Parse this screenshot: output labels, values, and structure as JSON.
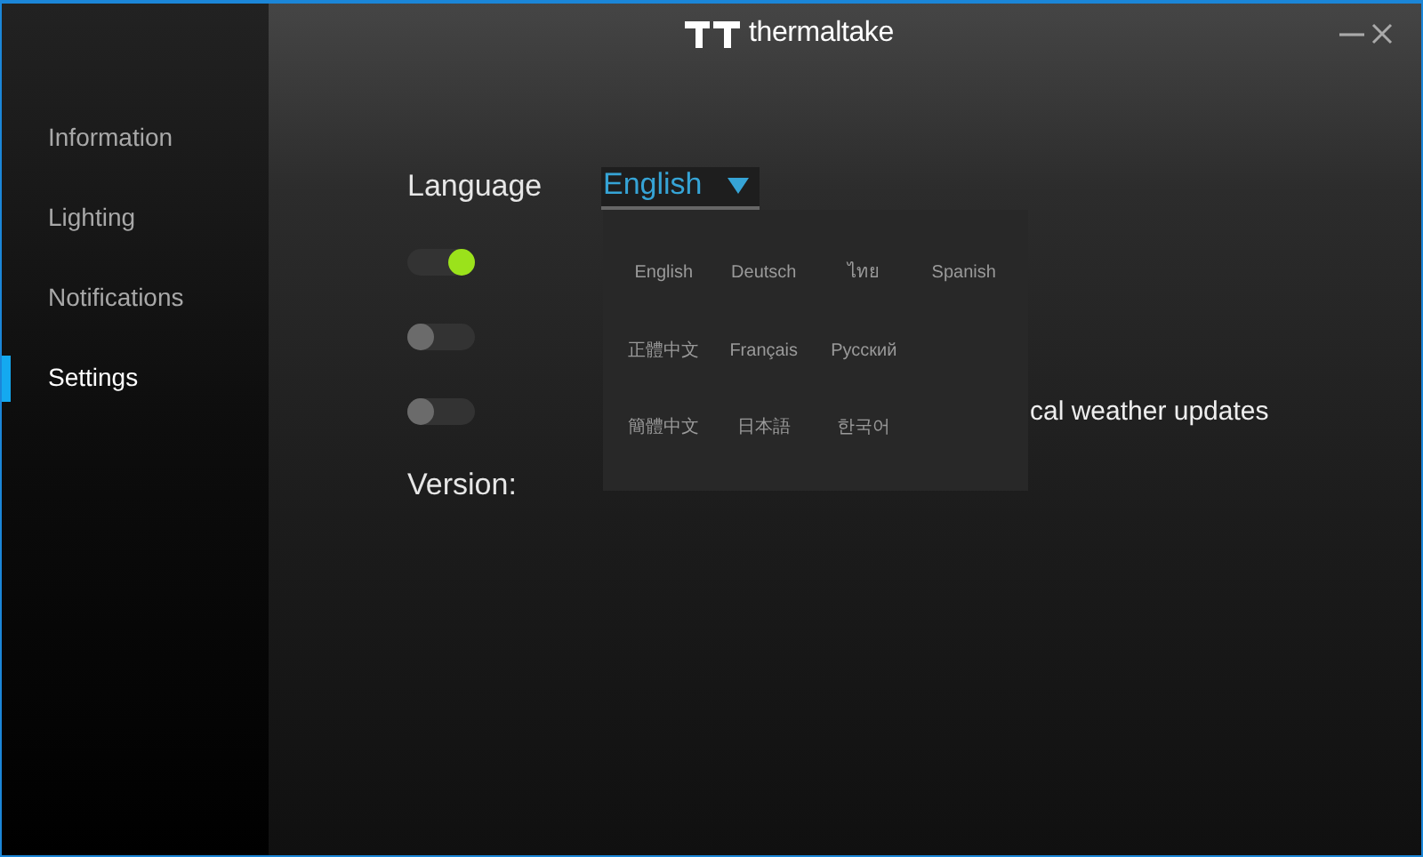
{
  "window": {
    "brand": "thermaltake"
  },
  "sidebar": {
    "items": [
      {
        "label": "Information",
        "selected": false
      },
      {
        "label": "Lighting",
        "selected": false
      },
      {
        "label": "Notifications",
        "selected": false
      },
      {
        "label": "Settings",
        "selected": true
      }
    ]
  },
  "settings": {
    "language": {
      "label": "Language",
      "value": "English",
      "expanded": true,
      "options": [
        {
          "label": "English"
        },
        {
          "label": "Deutsch"
        },
        {
          "label": "ไทย"
        },
        {
          "label": "Spanish"
        },
        {
          "label": "正體中文"
        },
        {
          "label": "Français"
        },
        {
          "label": "Русский"
        },
        {
          "label": "簡體中文"
        },
        {
          "label": "日本語"
        },
        {
          "label": "한국어"
        }
      ]
    },
    "toggles": [
      {
        "on": true
      },
      {
        "on": false
      },
      {
        "label": "cal weather updates",
        "on": false
      }
    ],
    "version": {
      "label": "Version:"
    }
  }
}
